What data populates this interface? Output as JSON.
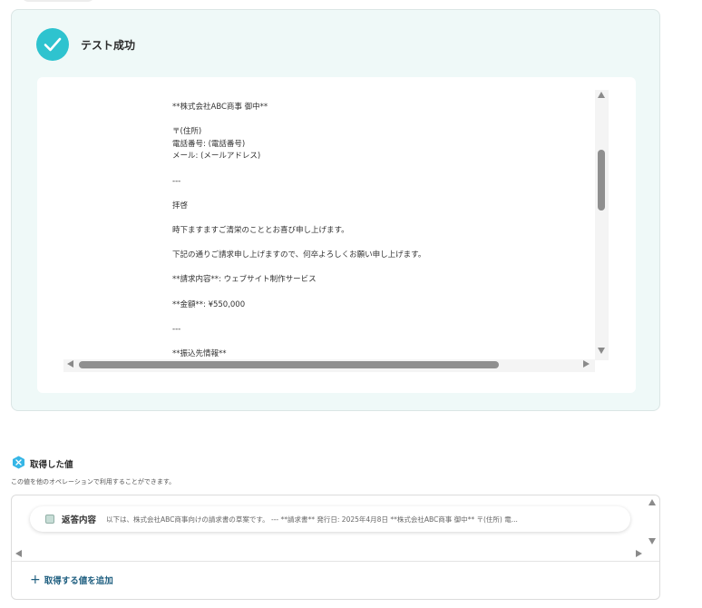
{
  "test_result": {
    "status_label": "テスト成功",
    "output_lines": [
      "**株式会社ABC商事 御中**",
      "",
      "〒(住所)",
      "電話番号: (電話番号)",
      "メール: (メールアドレス)",
      "",
      "---",
      "",
      "拝啓",
      "",
      "時下ますますご清栄のこととお喜び申し上げます。",
      "",
      "下記の通りご請求申し上げますので、何卒よろしくお願い申し上げます。",
      "",
      "**請求内容**: ウェブサイト制作サービス",
      "",
      "**金額**: ¥550,000",
      "",
      "---",
      "",
      "**振込先情報**"
    ]
  },
  "acquired_values": {
    "title": "取得した値",
    "description": "この値を他のオペレーションで利用することができます。",
    "items": [
      {
        "label": "返答内容",
        "value": "以下は、株式会社ABC商事向けの請求書の草案です。 --- **請求書** 発行日: 2025年4月8日 **株式会社ABC商事 御中** 〒(住所) 電..."
      }
    ],
    "add_label": "取得する値を追加"
  },
  "colors": {
    "success_accent": "#2ec3cf",
    "panel_bg": "#eff9f8",
    "link_color": "#1f5f80"
  },
  "icons": {
    "success": "check-circle-icon",
    "acquired": "variable-hex-icon",
    "value_item": "value-square-icon",
    "add": "plus-icon"
  }
}
